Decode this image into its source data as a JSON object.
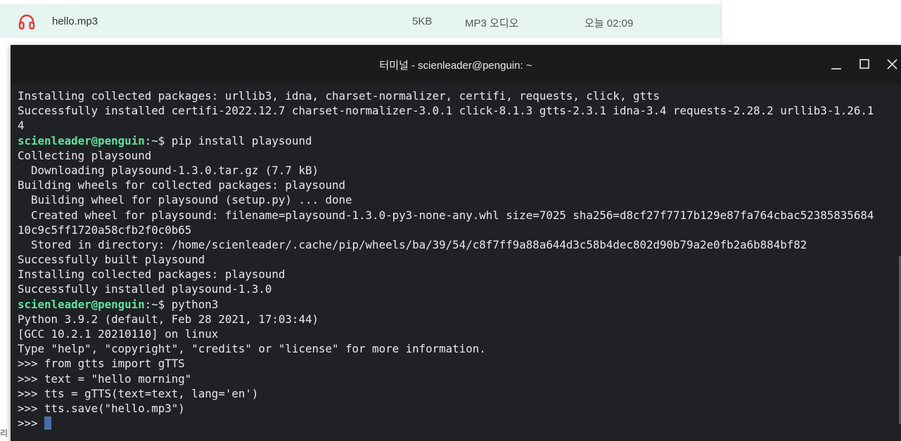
{
  "file_manager": {
    "file": {
      "name": "hello.mp3",
      "size": "5KB",
      "type": "MP3 오디오",
      "modified": "오늘 02:09",
      "icon": "headphones-icon",
      "icon_color": "#e53935"
    },
    "clipped_text": "리"
  },
  "terminal": {
    "title": "터미널 - scienleader@penguin: ~",
    "colors": {
      "background": "#202124",
      "prompt_user": "#5fe3a0",
      "cursor": "#4a6ea8"
    },
    "prompt_user": "scienleader@penguin",
    "prompt_path": ":~$ ",
    "lines": [
      {
        "kind": "out",
        "text": "Installing collected packages: urllib3, idna, charset-normalizer, certifi, requests, click, gtts"
      },
      {
        "kind": "out",
        "text": "Successfully installed certifi-2022.12.7 charset-normalizer-3.0.1 click-8.1.3 gtts-2.3.1 idna-3.4 requests-2.28.2 urllib3-1.26.1"
      },
      {
        "kind": "out",
        "text": "4"
      },
      {
        "kind": "prompt",
        "text": "pip install playsound"
      },
      {
        "kind": "out",
        "text": "Collecting playsound"
      },
      {
        "kind": "out",
        "text": "  Downloading playsound-1.3.0.tar.gz (7.7 kB)"
      },
      {
        "kind": "out",
        "text": "Building wheels for collected packages: playsound"
      },
      {
        "kind": "out",
        "text": "  Building wheel for playsound (setup.py) ... done"
      },
      {
        "kind": "out",
        "text": "  Created wheel for playsound: filename=playsound-1.3.0-py3-none-any.whl size=7025 sha256=d8cf27f7717b129e87fa764cbac52385835684"
      },
      {
        "kind": "out",
        "text": "10c9c5ff1720a58cfb2f0c0b65"
      },
      {
        "kind": "out",
        "text": "  Stored in directory: /home/scienleader/.cache/pip/wheels/ba/39/54/c8f7ff9a88a644d3c58b4dec802d90b79a2e0fb2a6b884bf82"
      },
      {
        "kind": "out",
        "text": "Successfully built playsound"
      },
      {
        "kind": "out",
        "text": "Installing collected packages: playsound"
      },
      {
        "kind": "out",
        "text": "Successfully installed playsound-1.3.0"
      },
      {
        "kind": "prompt",
        "text": "python3"
      },
      {
        "kind": "out",
        "text": "Python 3.9.2 (default, Feb 28 2021, 17:03:44)"
      },
      {
        "kind": "out",
        "text": "[GCC 10.2.1 20210110] on linux"
      },
      {
        "kind": "out",
        "text": "Type \"help\", \"copyright\", \"credits\" or \"license\" for more information."
      },
      {
        "kind": "out",
        "text": ">>> from gtts import gTTS"
      },
      {
        "kind": "out",
        "text": ">>> text = \"hello morning\""
      },
      {
        "kind": "out",
        "text": ">>> tts = gTTS(text=text, lang='en')"
      },
      {
        "kind": "out",
        "text": ">>> tts.save(\"hello.mp3\")"
      },
      {
        "kind": "cursor",
        "text": ">>> "
      }
    ]
  }
}
